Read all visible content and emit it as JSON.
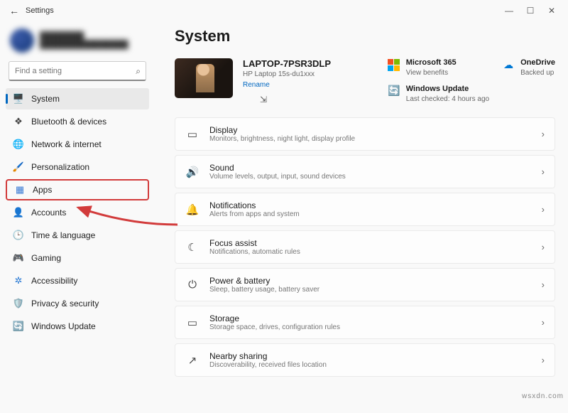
{
  "title": "Settings",
  "account": {
    "name": "████████",
    "email": "████████████████"
  },
  "search": {
    "placeholder": "Find a setting"
  },
  "sidebar": {
    "items": [
      {
        "label": "System",
        "icon": "🖥️",
        "color": "#3a7bd5"
      },
      {
        "label": "Bluetooth & devices",
        "icon": "❖",
        "color": "#444"
      },
      {
        "label": "Network & internet",
        "icon": "🌐",
        "color": "#2a7ad4"
      },
      {
        "label": "Personalization",
        "icon": "🖌️",
        "color": "#c98b2e"
      },
      {
        "label": "Apps",
        "icon": "▦",
        "color": "#3a7bd5"
      },
      {
        "label": "Accounts",
        "icon": "👤",
        "color": "#d05a5a"
      },
      {
        "label": "Time & language",
        "icon": "🕒",
        "color": "#444"
      },
      {
        "label": "Gaming",
        "icon": "🎮",
        "color": "#3aa35a"
      },
      {
        "label": "Accessibility",
        "icon": "✲",
        "color": "#2a7ad4"
      },
      {
        "label": "Privacy & security",
        "icon": "🛡️",
        "color": "#4a6aa0"
      },
      {
        "label": "Windows Update",
        "icon": "🔄",
        "color": "#0aa0e0"
      }
    ],
    "active": 0,
    "highlighted": 4
  },
  "main": {
    "heading": "System",
    "device": {
      "name": "LAPTOP-7PSR3DLP",
      "model": "HP Laptop 15s-du1xxx",
      "rename": "Rename"
    },
    "hero": [
      {
        "title": "Microsoft 365",
        "sub": "View benefits",
        "icon": "ms"
      },
      {
        "title": "OneDrive",
        "sub": "Backed up",
        "icon": "cloud"
      },
      {
        "title": "Windows Update",
        "sub": "Last checked: 4 hours ago",
        "icon": "update"
      }
    ],
    "cards": [
      {
        "icon": "▭",
        "title": "Display",
        "desc": "Monitors, brightness, night light, display profile"
      },
      {
        "icon": "🔊",
        "title": "Sound",
        "desc": "Volume levels, output, input, sound devices"
      },
      {
        "icon": "🔔",
        "title": "Notifications",
        "desc": "Alerts from apps and system"
      },
      {
        "icon": "☾",
        "title": "Focus assist",
        "desc": "Notifications, automatic rules"
      },
      {
        "icon": "⏻",
        "title": "Power & battery",
        "desc": "Sleep, battery usage, battery saver"
      },
      {
        "icon": "▭",
        "title": "Storage",
        "desc": "Storage space, drives, configuration rules"
      },
      {
        "icon": "↗",
        "title": "Nearby sharing",
        "desc": "Discoverability, received files location"
      }
    ]
  },
  "watermark": "wsxdn.com"
}
